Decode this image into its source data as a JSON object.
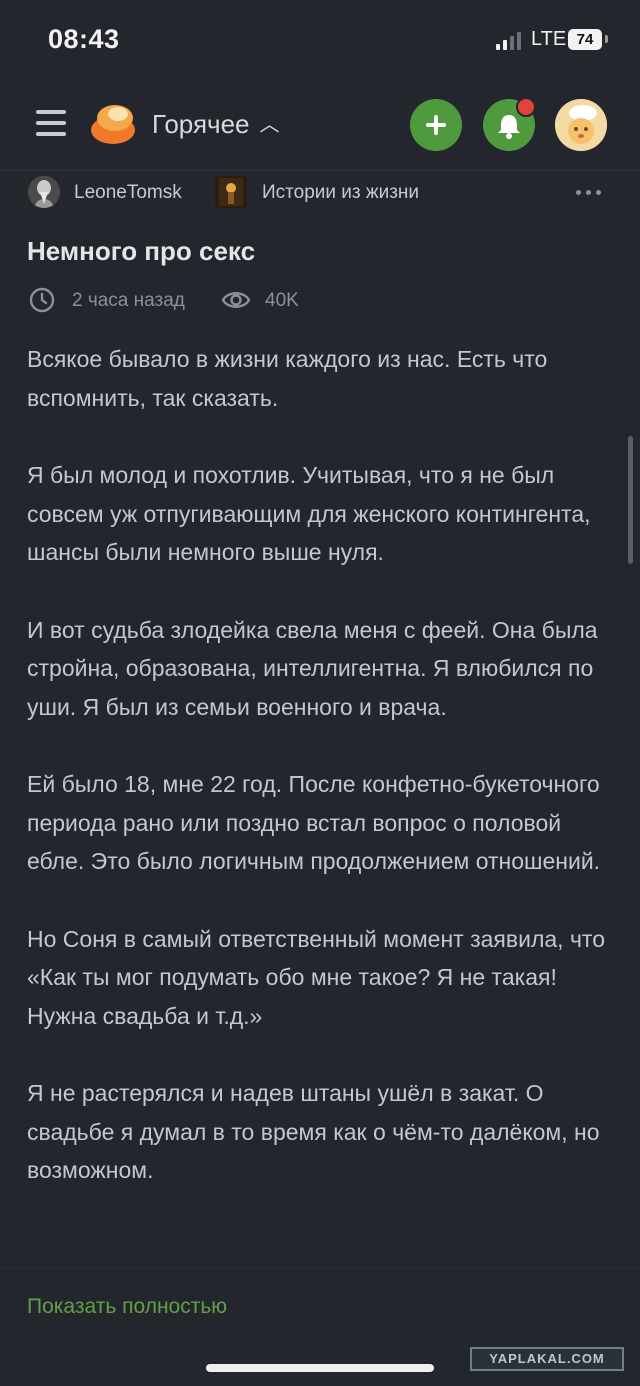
{
  "status_bar": {
    "time": "08:43",
    "network": "LTE",
    "battery": "74"
  },
  "header": {
    "feed_title": "Горячее",
    "icons": [
      "menu-icon",
      "logo-icon",
      "chevron-up-icon",
      "plus-icon",
      "bell-icon",
      "avatar"
    ],
    "accent_color": "#4f9a3d",
    "badge_color": "#e0443a"
  },
  "post": {
    "author": "LeoneTomsk",
    "community": "Истории из жизни",
    "title": "Немного про секс",
    "time_ago": "2 часа назад",
    "views": "40K",
    "paragraphs": [
      "Всякое бывало в жизни каждого из нас. Есть что вспомнить, так сказать.",
      "Я был молод и похотлив. Учитывая, что я не был совсем уж отпугивающим для женского контингента, шансы были немного выше нуля.",
      "И вот судьба злодейка свела меня с феей. Она была стройна, образована, интеллигентна. Я влюбился по уши. Я был из семьи военного и врача.",
      "Ей было 18, мне 22 год. После конфетно-букеточного периода рано или поздно встал вопрос о половой ебле. Это было логичным продолжением отношений.",
      "Но Соня в самый ответственный момент заявила, что «Как ты мог подумать обо мне такое? Я не такая! Нужна свадьба и т.д.»",
      "Я не растерялся и надев штаны ушёл в закат. О свадьбе я думал в то время как о чём-то далёком, но возможном."
    ],
    "show_full_label": "Показать полностью",
    "link_color": "#5fa048"
  },
  "watermark": "YAPLAKAL.COM"
}
